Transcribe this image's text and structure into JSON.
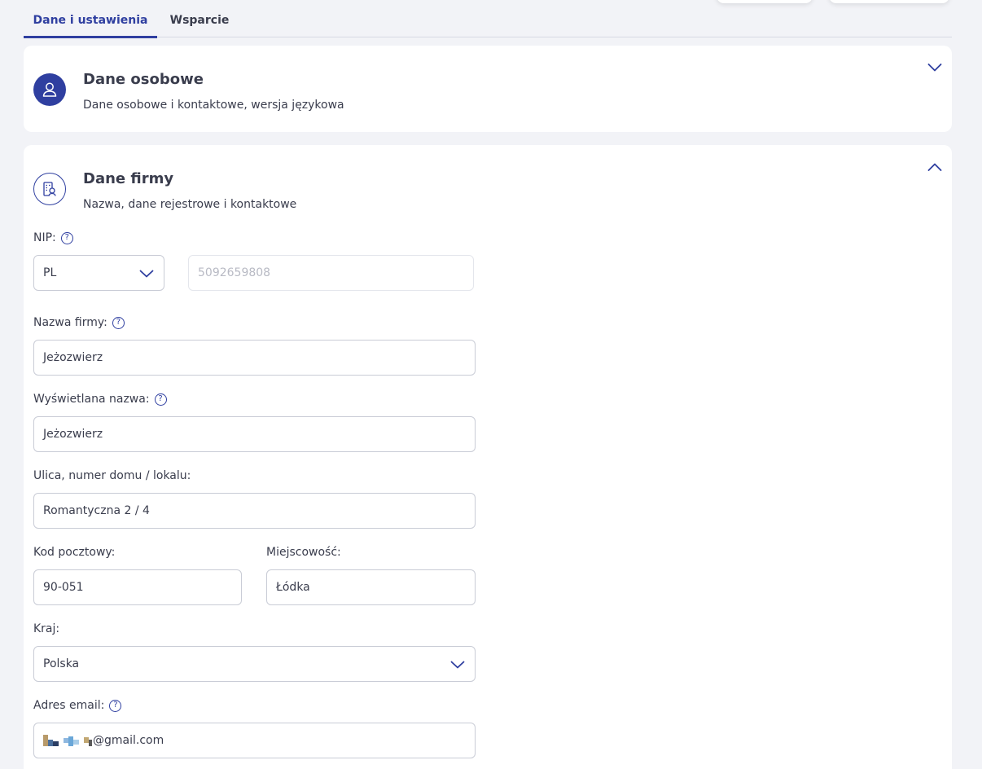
{
  "tabs": [
    {
      "label": "Dane i ustawienia",
      "active": true
    },
    {
      "label": "Wsparcie",
      "active": false
    }
  ],
  "personal_card": {
    "title": "Dane osobowe",
    "subtitle": "Dane osobowe i kontaktowe, wersja językowa",
    "icon": "user-icon",
    "expanded": false
  },
  "company_card": {
    "title": "Dane firmy",
    "subtitle": "Nazwa, dane rejestrowe i kontaktowe",
    "icon": "building-icon",
    "expanded": true
  },
  "form": {
    "nip": {
      "label": "NIP:",
      "country": "PL",
      "value": "5092659808"
    },
    "company_name": {
      "label": "Nazwa firmy:",
      "value": "Jeżozwierz"
    },
    "display_name": {
      "label": "Wyświetlana nazwa:",
      "value": "Jeżozwierz"
    },
    "street": {
      "label": "Ulica, numer domu / lokalu:",
      "value": "Romantyczna 2 / 4"
    },
    "postal_code": {
      "label": "Kod pocztowy:",
      "value": "90-051"
    },
    "city": {
      "label": "Miejscowość:",
      "value": "Łódka"
    },
    "country": {
      "label": "Kraj:",
      "value": "Polska"
    },
    "email": {
      "label": "Adres email:",
      "value_suffix": "@gmail.com"
    }
  },
  "colors": {
    "accent": "#2f3fa0",
    "background": "#f2f3f7",
    "card": "#ffffff",
    "border": "#c9ccd6"
  },
  "help_glyph": "?"
}
